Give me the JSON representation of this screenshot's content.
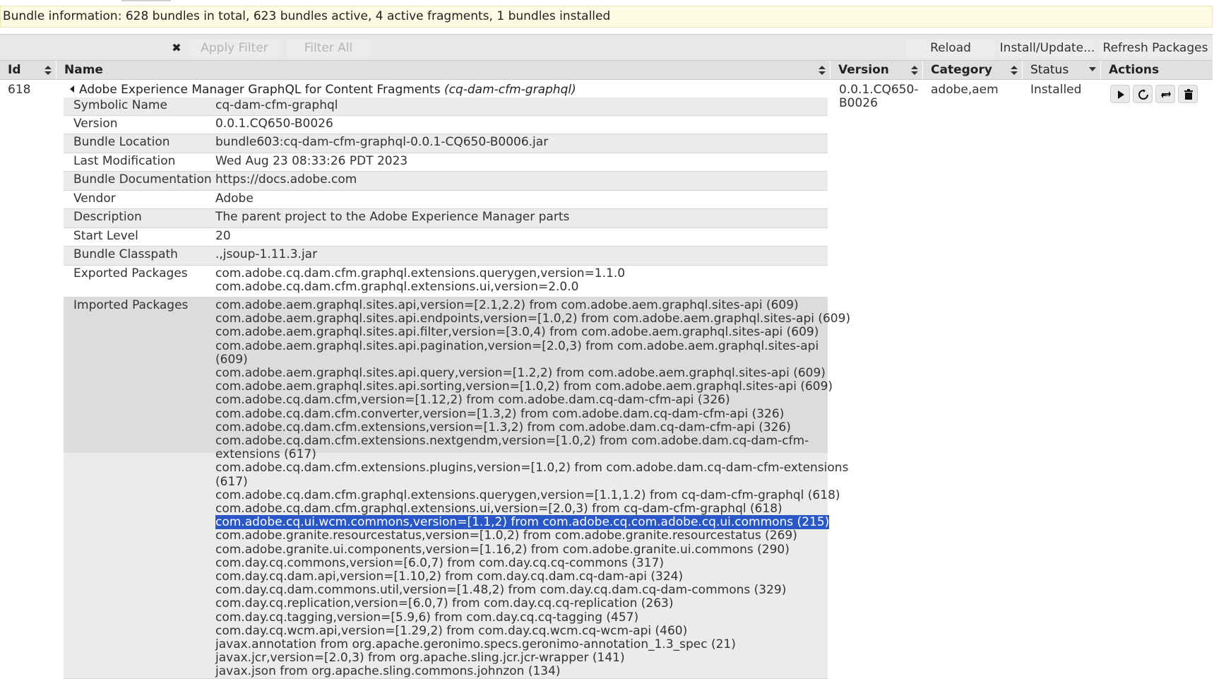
{
  "status": {
    "text": "Bundle information: 628 bundles in total, 623 bundles active, 4 active fragments, 1 bundles installed"
  },
  "toolbar": {
    "filter_value": "",
    "clear_symbol": "✖",
    "apply_filter": "Apply Filter",
    "filter_all": "Filter All",
    "reload": "Reload",
    "install_update": "Install/Update...",
    "refresh_packages": "Refresh Packages"
  },
  "table": {
    "headers": {
      "id": "Id",
      "name": "Name",
      "version": "Version",
      "category": "Category",
      "status": "Status",
      "actions": "Actions"
    },
    "bundle": {
      "id": "618",
      "name": "Adobe Experience Manager GraphQL for Content Fragments",
      "symbolic_paren": "(cq-dam-cfm-graphql)",
      "version_line1": "0.0.1.CQ650-",
      "version_line2": "B0026",
      "category": "adobe,aem",
      "status": "Installed"
    },
    "action_icons": [
      "play-icon",
      "refresh-icon",
      "update-icon",
      "trash-icon"
    ]
  },
  "details": {
    "symbolic_name": {
      "label": "Symbolic Name",
      "value": "cq-dam-cfm-graphql"
    },
    "version": {
      "label": "Version",
      "value": "0.0.1.CQ650-B0026"
    },
    "bundle_location": {
      "label": "Bundle Location",
      "value": "bundle603:cq-dam-cfm-graphql-0.0.1-CQ650-B0006.jar"
    },
    "last_modification": {
      "label": "Last Modification",
      "value": "Wed Aug 23 08:33:26 PDT 2023"
    },
    "bundle_documentation": {
      "label": "Bundle Documentation",
      "value": "https://docs.adobe.com"
    },
    "vendor": {
      "label": "Vendor",
      "value": "Adobe"
    },
    "description": {
      "label": "Description",
      "value": "The parent project to the Adobe Experience Manager parts"
    },
    "start_level": {
      "label": "Start Level",
      "value": "20"
    },
    "bundle_classpath": {
      "label": "Bundle Classpath",
      "value": ".,jsoup-1.11.3.jar"
    },
    "exported_packages": {
      "label": "Exported Packages",
      "values": [
        "com.adobe.cq.dam.cfm.graphql.extensions.querygen,version=1.1.0",
        "com.adobe.cq.dam.cfm.graphql.extensions.ui,version=2.0.0"
      ]
    },
    "imported_packages": {
      "label": "Imported Packages",
      "values": [
        "com.adobe.aem.graphql.sites.api,version=[2.1,2.2) from com.adobe.aem.graphql.sites-api (609)",
        "com.adobe.aem.graphql.sites.api.endpoints,version=[1.0,2) from com.adobe.aem.graphql.sites-api (609)",
        "com.adobe.aem.graphql.sites.api.filter,version=[3.0,4) from com.adobe.aem.graphql.sites-api (609)",
        "com.adobe.aem.graphql.sites.api.pagination,version=[2.0,3) from com.adobe.aem.graphql.sites-api",
        "(609)",
        "com.adobe.aem.graphql.sites.api.query,version=[1.2,2) from com.adobe.aem.graphql.sites-api (609)",
        "com.adobe.aem.graphql.sites.api.sorting,version=[1.0,2) from com.adobe.aem.graphql.sites-api (609)",
        "com.adobe.cq.dam.cfm,version=[1.12,2) from com.adobe.dam.cq-dam-cfm-api (326)",
        "com.adobe.cq.dam.cfm.converter,version=[1.3,2) from com.adobe.dam.cq-dam-cfm-api (326)",
        "com.adobe.cq.dam.cfm.extensions,version=[1.3,2) from com.adobe.dam.cq-dam-cfm-api (326)",
        "com.adobe.cq.dam.cfm.extensions.nextgendm,version=[1.0,2) from com.adobe.dam.cq-dam-cfm-",
        "extensions (617)",
        "com.adobe.cq.dam.cfm.extensions.plugins,version=[1.0,2) from com.adobe.dam.cq-dam-cfm-extensions",
        "(617)",
        "com.adobe.cq.dam.cfm.graphql.extensions.querygen,version=[1.1,1.2) from cq-dam-cfm-graphql (618)",
        "com.adobe.cq.dam.cfm.graphql.extensions.ui,version=[2.0,3) from cq-dam-cfm-graphql (618)",
        "com.adobe.cq.ui.wcm.commons,version=[1.1,2) from com.adobe.cq.com.adobe.cq.ui.commons (215)",
        "com.adobe.granite.resourcestatus,version=[1.0,2) from com.adobe.granite.resourcestatus (269)",
        "com.adobe.granite.ui.components,version=[1.16,2) from com.adobe.granite.ui.commons (290)",
        "com.day.cq.commons,version=[6.0,7) from com.day.cq.cq-commons (317)",
        "com.day.cq.dam.api,version=[1.10,2) from com.day.cq.dam.cq-dam-api (324)",
        "com.day.cq.dam.commons.util,version=[1.48,2) from com.day.cq.dam.cq-dam-commons (329)",
        "com.day.cq.replication,version=[6.0,7) from com.day.cq.cq-replication (263)",
        "com.day.cq.tagging,version=[5.9,6) from com.day.cq.cq-tagging (457)",
        "com.day.cq.wcm.api,version=[1.29,2) from com.day.cq.wcm.cq-wcm-api (460)",
        "javax.annotation from org.apache.geronimo.specs.geronimo-annotation_1.3_spec (21)",
        "javax.jcr,version=[2.0,3) from org.apache.sling.jcr.jcr-wrapper (141)",
        "javax.json from org.apache.sling.commons.johnzon (134)"
      ]
    }
  }
}
